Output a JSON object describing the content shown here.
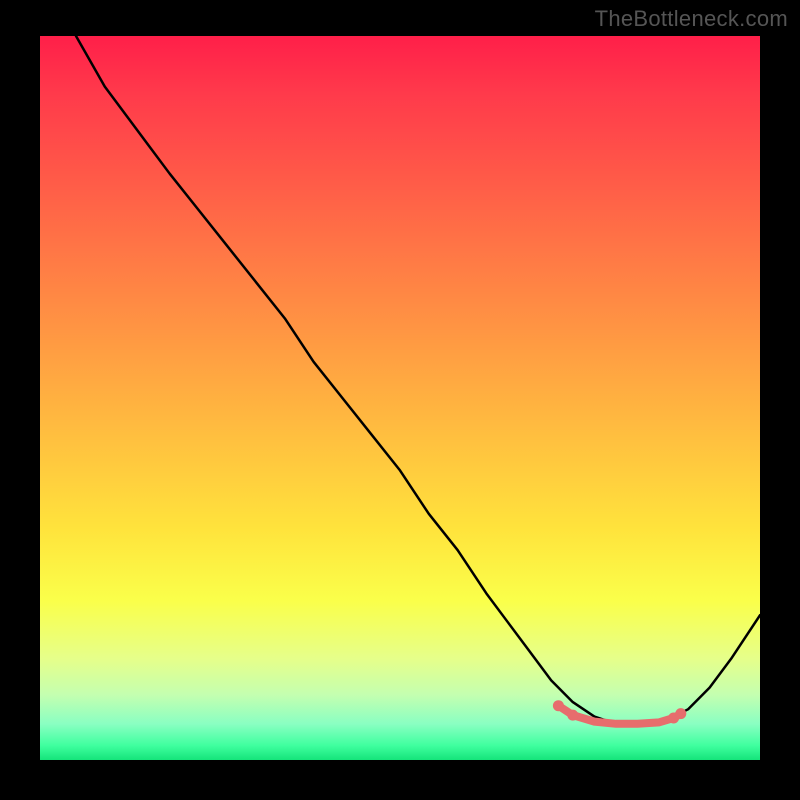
{
  "watermark": {
    "text": "TheBottleneck.com"
  },
  "colors": {
    "background": "#000000",
    "curve_stroke": "#000000",
    "highlight_stroke": "#e76d6d",
    "gradient_top": "#ff1f49",
    "gradient_bottom": "#15e47a"
  },
  "chart_data": {
    "type": "line",
    "title": "",
    "xlabel": "",
    "ylabel": "",
    "xlim": [
      0,
      100
    ],
    "ylim": [
      0,
      100
    ],
    "grid": false,
    "series": [
      {
        "name": "bottleneck-curve",
        "x": [
          5,
          9,
          12,
          15,
          18,
          22,
          26,
          30,
          34,
          38,
          42,
          46,
          50,
          54,
          58,
          62,
          65,
          68,
          71,
          74,
          77,
          80,
          83,
          86,
          88,
          90,
          93,
          96,
          100
        ],
        "y": [
          100,
          93,
          89,
          85,
          81,
          76,
          71,
          66,
          61,
          55,
          50,
          45,
          40,
          34,
          29,
          23,
          19,
          15,
          11,
          8,
          6,
          5,
          5,
          5,
          6,
          7,
          10,
          14,
          20
        ]
      },
      {
        "name": "optimal-range",
        "x": [
          72,
          74,
          77,
          80,
          83,
          86,
          88,
          89
        ],
        "y": [
          7.5,
          6.2,
          5.3,
          5,
          5,
          5.2,
          5.8,
          6.4
        ]
      }
    ],
    "annotations": []
  }
}
